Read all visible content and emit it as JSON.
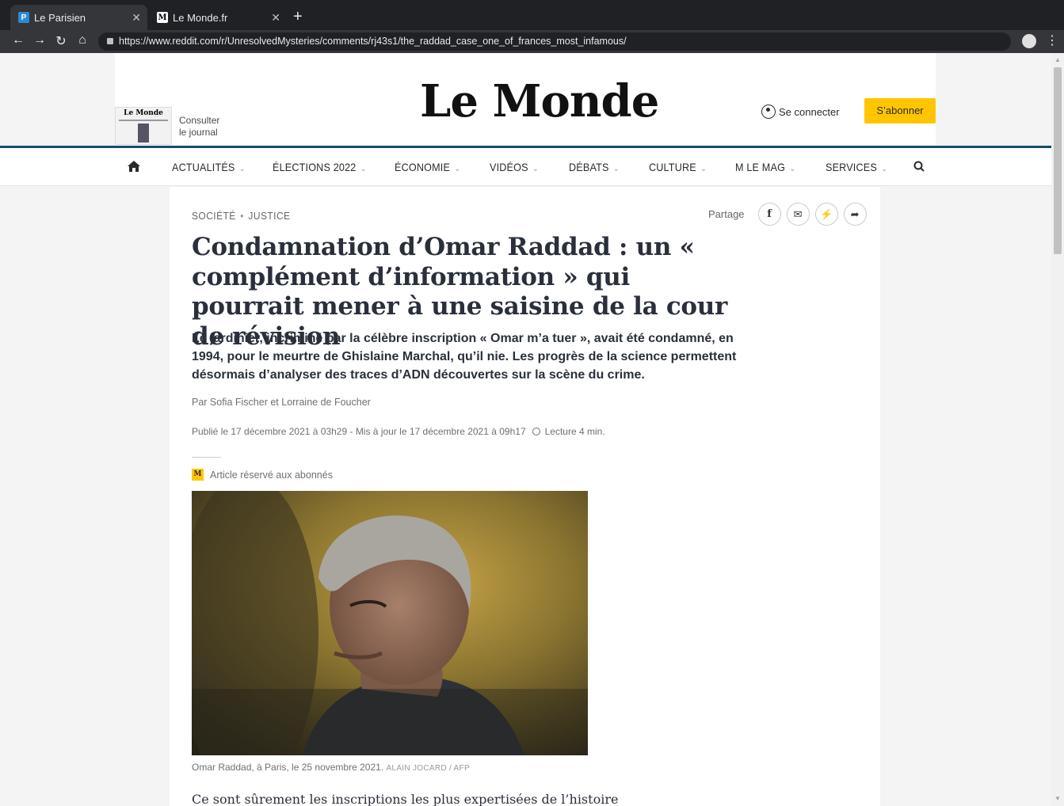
{
  "browser": {
    "tabs": [
      {
        "label": "Le Parisien",
        "favicon": "P",
        "active": true
      },
      {
        "label": "Le Monde.fr",
        "favicon": "M",
        "active": false
      }
    ],
    "url": "https://www.reddit.com/r/UnresolvedMysteries/comments/rj43s1/the_raddad_case_one_of_frances_most_infamous/"
  },
  "header": {
    "logo": "Le Monde",
    "journal_mini_logo": "Le Monde",
    "consult_line1": "Consulter",
    "consult_line2": "le journal",
    "login_label": "Se connecter",
    "subscribe_label": "S’abonner"
  },
  "nav": {
    "items": [
      {
        "label": "ACTUALITÉS"
      },
      {
        "label": "ÉLECTIONS 2022"
      },
      {
        "label": "ÉCONOMIE"
      },
      {
        "label": "VIDÉOS"
      },
      {
        "label": "DÉBATS"
      },
      {
        "label": "CULTURE"
      },
      {
        "label": "M LE MAG"
      },
      {
        "label": "SERVICES"
      }
    ]
  },
  "article": {
    "category": "SOCIÉTÉ",
    "subcategory": "JUSTICE",
    "share_label": "Partage",
    "title": "Condamnation d’Omar Raddad : un « complément d’information » qui pourrait mener à une saisine de la cour de révision",
    "chapo": "Le jardinier, incriminé par la célèbre inscription « Omar m’a tuer », avait été condamné, en 1994, pour le meurtre de Ghislaine Marchal, qu’il nie. Les progrès de la science permettent désormais d’analyser des traces d’ADN découvertes sur la scène du crime.",
    "authors": "Par Sofia Fischer et Lorraine de Foucher",
    "dates": "Publié le 17 décembre 2021 à 03h29 - Mis à jour le 17 décembre 2021 à 09h17",
    "reading_time": "Lecture 4 min.",
    "reserved_badge": "M",
    "reserved_label": "Article réservé aux abonnés",
    "caption": "Omar Raddad, à Paris, le 25 novembre 2021.",
    "credit": "ALAIN JOCARD / AFP",
    "body_start": "Ce sont sûrement les inscriptions les plus expertisées de l’histoire"
  }
}
